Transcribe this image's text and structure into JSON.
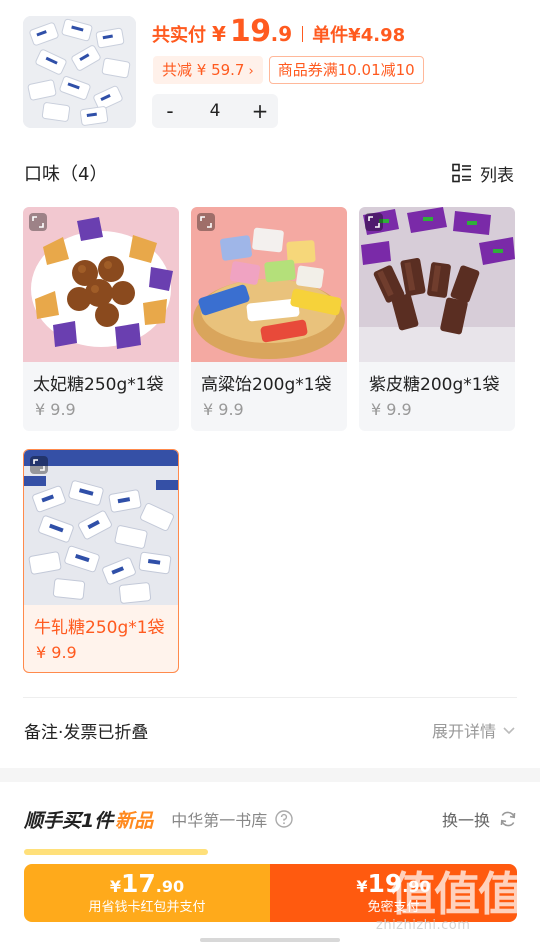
{
  "summary": {
    "total_label": "共实付",
    "currency": "¥",
    "total_int": "19",
    "total_dec": ".9",
    "unit_label": "单件¥4.98",
    "save_tag": "共减 ¥ 59.7",
    "save_chevron": "›",
    "coupon_tag": "商品券满10.01减10",
    "minus": "-",
    "quantity": "4",
    "plus": "+"
  },
  "flavors": {
    "title": "口味（4）",
    "view_toggle": "列表",
    "items": [
      {
        "name": "太妃糖250g*1袋",
        "price": "¥ 9.9",
        "selected": false
      },
      {
        "name": "高粱饴200g*1袋",
        "price": "¥ 9.9",
        "selected": false
      },
      {
        "name": "紫皮糖200g*1袋",
        "price": "¥ 9.9",
        "selected": false
      },
      {
        "name": "牛轧糖250g*1袋",
        "price": "¥ 9.9",
        "selected": true
      }
    ]
  },
  "remark": {
    "title": "备注·发票已折叠",
    "expand": "展开详情"
  },
  "bundle": {
    "title": "顺手买1件",
    "tag": "新品",
    "subtitle": "中华第一书库",
    "swap": "换一换"
  },
  "paybar": {
    "left_currency": "¥",
    "left_int": "17",
    "left_dec": ".90",
    "left_sub": "用省钱卡红包并支付",
    "right_currency": "¥",
    "right_int": "19",
    "right_dec": ".90",
    "right_sub": "免密支付"
  },
  "watermark": {
    "logo": "值值值",
    "url": "zhizhizhi.com"
  },
  "colors": {
    "accent": "#ff5a1f",
    "pay_left": "#ffaa1b",
    "pay_right": "#ff5a0f"
  }
}
